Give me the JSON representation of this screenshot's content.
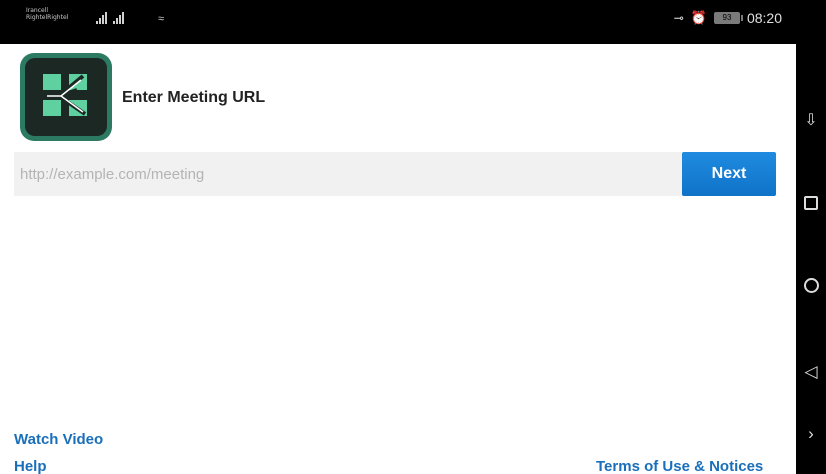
{
  "status_bar": {
    "carrier_line1": "Irancell",
    "carrier_line2": "RightelRightel",
    "time": "08:20",
    "battery": "93",
    "icons": [
      "signal-icon",
      "signal-icon",
      "wifi-icon",
      "key-icon",
      "alarm-icon",
      "battery-icon"
    ]
  },
  "app": {
    "icon": "adobe-connect-logo",
    "title": "Enter Meeting URL"
  },
  "url_input": {
    "value": "",
    "placeholder": "http://example.com/meeting"
  },
  "next_button": {
    "label": "Next"
  },
  "footer": {
    "watch_video": "Watch Video",
    "help": "Help",
    "terms": "Terms of Use & Notices"
  },
  "nav_bar": {
    "buttons": [
      "notification-pull-icon",
      "recents-square-icon",
      "home-circle-icon",
      "back-triangle-icon",
      "chevron-right-icon"
    ]
  },
  "colors": {
    "accent": "#1a6fba",
    "button": "#1380d6",
    "input_bg": "#f1f1f1",
    "icon_frame": "#2d7a62"
  }
}
